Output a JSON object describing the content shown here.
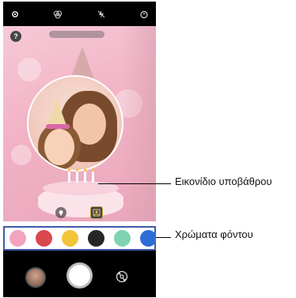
{
  "topbar": {
    "icons": [
      "gear-icon",
      "filter-icon",
      "flash-off-icon",
      "timer-icon"
    ]
  },
  "preview": {
    "help_label": "?"
  },
  "color_strip": {
    "swatches": [
      "#f2a3bf",
      "#d9474f",
      "#f2c43a",
      "#262626",
      "#7fd3b2",
      "#2c6dd6"
    ]
  },
  "callouts": {
    "background_icon": "Εικονίδιο υποβάθρου",
    "background_colors": "Χρώματα φόντου"
  },
  "bottombar": {
    "icons": [
      "gallery-thumbnail",
      "shutter-button",
      "switch-camera-icon"
    ]
  }
}
